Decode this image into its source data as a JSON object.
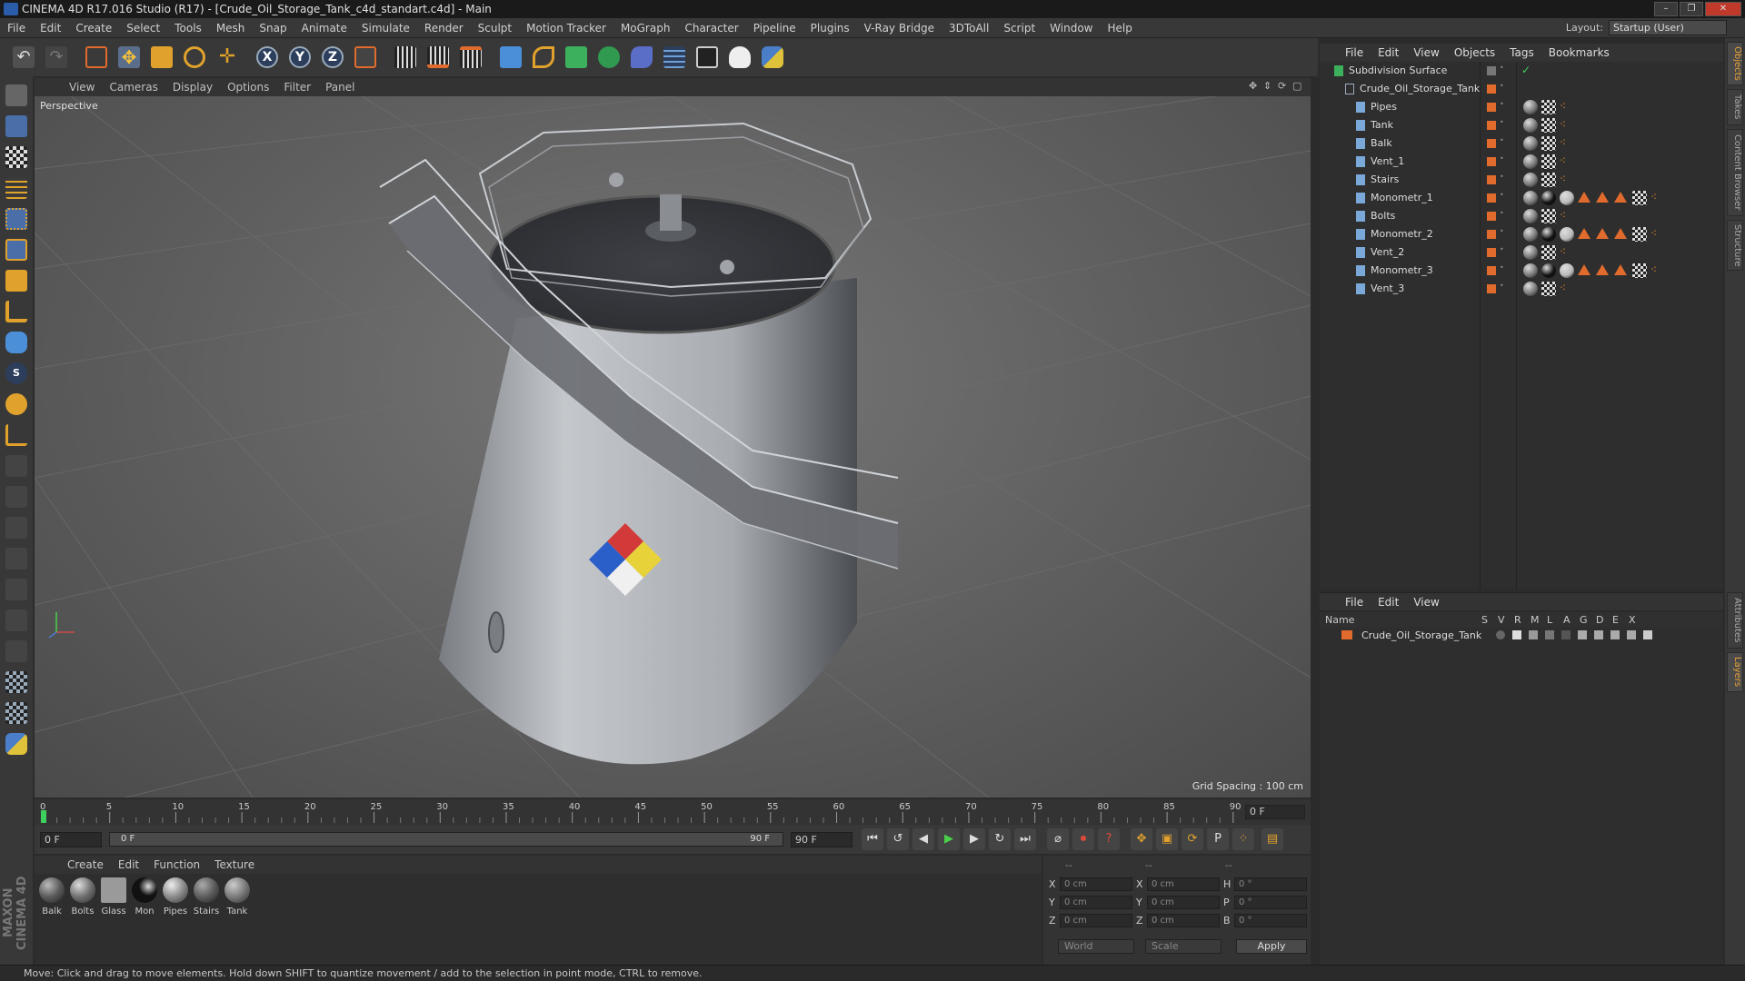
{
  "window": {
    "title": "CINEMA 4D R17.016 Studio (R17) - [Crude_Oil_Storage_Tank_c4d_standart.c4d] - Main"
  },
  "menubar": {
    "items": [
      "File",
      "Edit",
      "Create",
      "Select",
      "Tools",
      "Mesh",
      "Snap",
      "Animate",
      "Simulate",
      "Render",
      "Sculpt",
      "Motion Tracker",
      "MoGraph",
      "Character",
      "Pipeline",
      "Plugins",
      "V-Ray Bridge",
      "3DToAll",
      "Script",
      "Window",
      "Help"
    ],
    "layout_label": "Layout:",
    "layout_value": "Startup (User)"
  },
  "toolbar": {
    "icons": [
      "undo-icon",
      "redo-icon",
      "live-select-icon",
      "move-icon",
      "scale-icon",
      "rotate-icon",
      "add-icon",
      "x-axis-icon",
      "y-axis-icon",
      "z-axis-icon",
      "coordinate-system-icon",
      "render-view-icon",
      "render-picture-viewer-icon",
      "render-settings-icon",
      "cube-icon",
      "pen-icon",
      "subdivision-icon",
      "cloner-icon",
      "deformer-icon",
      "floor-icon",
      "camera-icon",
      "light-icon",
      "python-icon"
    ],
    "axis_labels": [
      "X",
      "Y",
      "Z"
    ]
  },
  "viewport": {
    "menu": [
      "View",
      "Cameras",
      "Display",
      "Options",
      "Filter",
      "Panel"
    ],
    "camera_label": "Perspective",
    "grid_spacing": "Grid Spacing : 100 cm"
  },
  "timeline": {
    "ticks": [
      "0",
      "5",
      "10",
      "15",
      "20",
      "25",
      "30",
      "35",
      "40",
      "45",
      "50",
      "55",
      "60",
      "65",
      "70",
      "75",
      "80",
      "85",
      "90"
    ],
    "current_frame": "0 F"
  },
  "transport": {
    "start_frame": "0 F",
    "range_start": "0 F",
    "range_end": "90 F",
    "end_frame": "90 F"
  },
  "materials": {
    "menu": [
      "Create",
      "Edit",
      "Function",
      "Texture"
    ],
    "items": [
      {
        "name": "Balk",
        "color": "#5a5a5a"
      },
      {
        "name": "Bolts",
        "color": "#707070"
      },
      {
        "name": "Glass",
        "color": "#9a9a9a"
      },
      {
        "name": "Mon",
        "color": "#111111"
      },
      {
        "name": "Pipes",
        "color": "#8a8a8a"
      },
      {
        "name": "Stairs",
        "color": "#5c5c5c"
      },
      {
        "name": "Tank",
        "color": "#7a7a7a"
      }
    ]
  },
  "coordinates": {
    "headers": [
      "--",
      "--",
      "--"
    ],
    "rows": [
      {
        "a": "X",
        "av": "0 cm",
        "b": "X",
        "bv": "0 cm",
        "c": "H",
        "cv": "0 °"
      },
      {
        "a": "Y",
        "av": "0 cm",
        "b": "Y",
        "bv": "0 cm",
        "c": "P",
        "cv": "0 °"
      },
      {
        "a": "Z",
        "av": "0 cm",
        "b": "Z",
        "bv": "0 cm",
        "c": "B",
        "cv": "0 °"
      }
    ],
    "space": "World",
    "mode": "Scale",
    "apply": "Apply"
  },
  "status": {
    "text": "Move: Click and drag to move elements. Hold down SHIFT to quantize movement / add to the selection in point mode, CTRL to remove."
  },
  "objects": {
    "menu": [
      "File",
      "Edit",
      "View",
      "Objects",
      "Tags",
      "Bookmarks"
    ],
    "items": [
      {
        "name": "Subdivision Surface",
        "level": 0,
        "tags": "check"
      },
      {
        "name": "Crude_Oil_Storage_Tank",
        "level": 1,
        "tags": "none"
      },
      {
        "name": "Pipes",
        "level": 2,
        "tags": "basic"
      },
      {
        "name": "Tank",
        "level": 2,
        "tags": "basic"
      },
      {
        "name": "Balk",
        "level": 2,
        "tags": "basic"
      },
      {
        "name": "Vent_1",
        "level": 2,
        "tags": "basic"
      },
      {
        "name": "Stairs",
        "level": 2,
        "tags": "basic"
      },
      {
        "name": "Monometr_1",
        "level": 2,
        "tags": "full"
      },
      {
        "name": "Bolts",
        "level": 2,
        "tags": "basic"
      },
      {
        "name": "Monometr_2",
        "level": 2,
        "tags": "full"
      },
      {
        "name": "Vent_2",
        "level": 2,
        "tags": "basic"
      },
      {
        "name": "Monometr_3",
        "level": 2,
        "tags": "full"
      },
      {
        "name": "Vent_3",
        "level": 2,
        "tags": "basic"
      }
    ]
  },
  "layers": {
    "menu": [
      "File",
      "Edit",
      "View"
    ],
    "headers": [
      "Name",
      "S",
      "V",
      "R",
      "M",
      "L",
      "A",
      "G",
      "D",
      "E",
      "X"
    ],
    "items": [
      {
        "name": "Crude_Oil_Storage_Tank",
        "color": "#e06b2c"
      }
    ]
  },
  "side_tabs": [
    "Objects",
    "Takes",
    "Content Browser",
    "Structure",
    "Attributes",
    "Layers"
  ],
  "brand": "MAXON CINEMA 4D"
}
